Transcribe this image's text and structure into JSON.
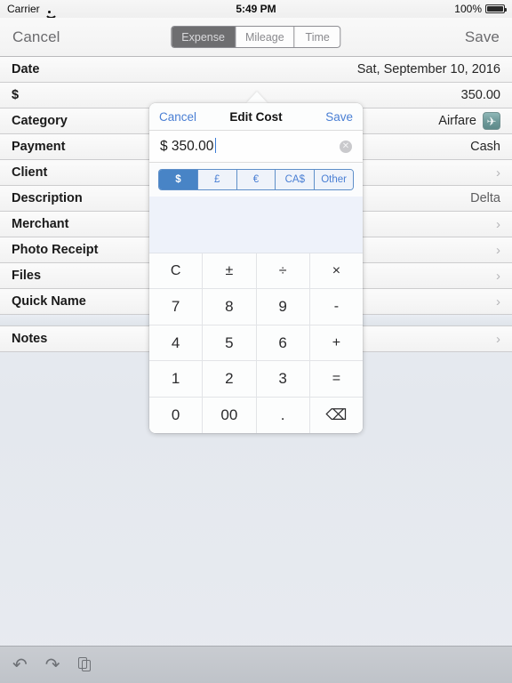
{
  "status_bar": {
    "carrier": "Carrier",
    "wifi_icon": "wifi-icon",
    "time": "5:49 PM",
    "battery_percent": "100%",
    "battery_icon": "battery-full-icon"
  },
  "navbar": {
    "cancel_label": "Cancel",
    "save_label": "Save",
    "segments": [
      {
        "label": "Expense",
        "selected": true
      },
      {
        "label": "Mileage",
        "selected": false
      },
      {
        "label": "Time",
        "selected": false
      }
    ]
  },
  "form": {
    "section1": [
      {
        "label": "Date",
        "value": "Sat,  September 10, 2016",
        "chevron": false,
        "icon": null
      },
      {
        "label": "$",
        "value": "350.00",
        "chevron": false,
        "icon": null
      },
      {
        "label": "Category",
        "value": "Airfare",
        "chevron": false,
        "icon": "airplane-icon"
      },
      {
        "label": "Payment",
        "value": "Cash",
        "chevron": false,
        "icon": null
      },
      {
        "label": "Client",
        "value": "",
        "chevron": true,
        "icon": null
      },
      {
        "label": "Description",
        "value": "Delta",
        "chevron": false,
        "icon": null
      },
      {
        "label": "Merchant",
        "value": "",
        "chevron": true,
        "icon": null
      },
      {
        "label": "Photo Receipt",
        "value": "",
        "chevron": true,
        "icon": null
      },
      {
        "label": "Files",
        "value": "",
        "chevron": true,
        "icon": null
      },
      {
        "label": "Quick Name",
        "value": "",
        "chevron": true,
        "icon": null
      }
    ],
    "section2": [
      {
        "label": "Notes",
        "value": "",
        "chevron": true,
        "icon": null
      }
    ]
  },
  "popover": {
    "cancel_label": "Cancel",
    "title": "Edit Cost",
    "save_label": "Save",
    "input_value": "$ 350.00",
    "clear_icon": "clear-circle-icon",
    "currency_segments": [
      {
        "label": "$",
        "selected": true
      },
      {
        "label": "£",
        "selected": false
      },
      {
        "label": "€",
        "selected": false
      },
      {
        "label": "CA$",
        "selected": false
      },
      {
        "label": "Other",
        "selected": false
      }
    ],
    "keypad": [
      [
        "C",
        "±",
        "÷",
        "×"
      ],
      [
        "7",
        "8",
        "9",
        "-"
      ],
      [
        "4",
        "5",
        "6",
        "+"
      ],
      [
        "1",
        "2",
        "3",
        "="
      ],
      [
        "0",
        "00",
        ".",
        "⌫"
      ]
    ]
  },
  "toolbar": {
    "undo_icon": "undo-icon",
    "redo_icon": "redo-icon",
    "duplicate_icon": "duplicate-icon"
  },
  "colors": {
    "accent_blue": "#4a7fd4",
    "segment_selected": "#4884c6",
    "nav_segment_selected": "#6e6e70"
  }
}
